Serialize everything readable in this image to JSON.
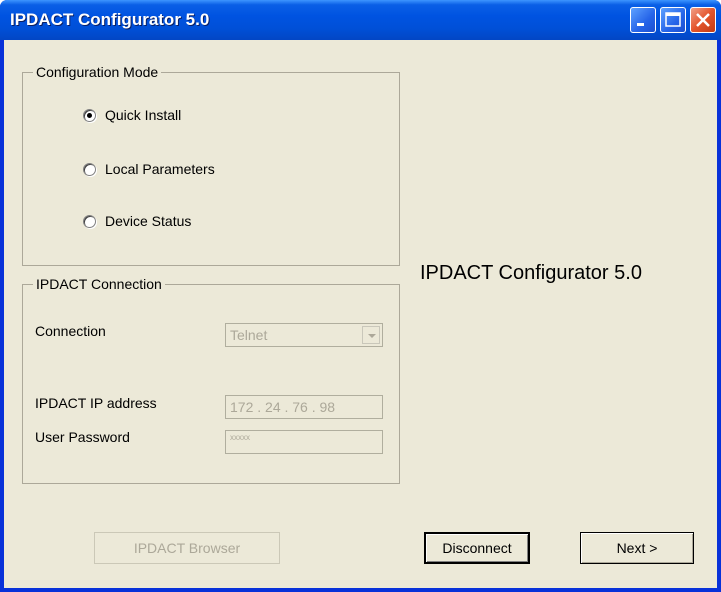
{
  "window": {
    "title": "IPDACT Configurator 5.0",
    "controls": [
      "minimize-icon",
      "maximize-icon",
      "close-icon"
    ]
  },
  "configuration_mode": {
    "title": "Configuration Mode",
    "options": [
      {
        "label": "Quick Install",
        "checked": true
      },
      {
        "label": "Local Parameters",
        "checked": false
      },
      {
        "label": "Device Status",
        "checked": false
      }
    ]
  },
  "connection_group": {
    "title": "IPDACT Connection",
    "connection_label": "Connection",
    "connection_value": "Telnet",
    "ip_label": "IPDACT IP address",
    "ip_value": "172 . 24 . 76 . 98",
    "password_label": "User Password",
    "password_value": "xxxxx"
  },
  "heading": "IPDACT Configurator 5.0",
  "buttons": {
    "browser": "IPDACT Browser",
    "disconnect": "Disconnect",
    "next": "Next >"
  }
}
